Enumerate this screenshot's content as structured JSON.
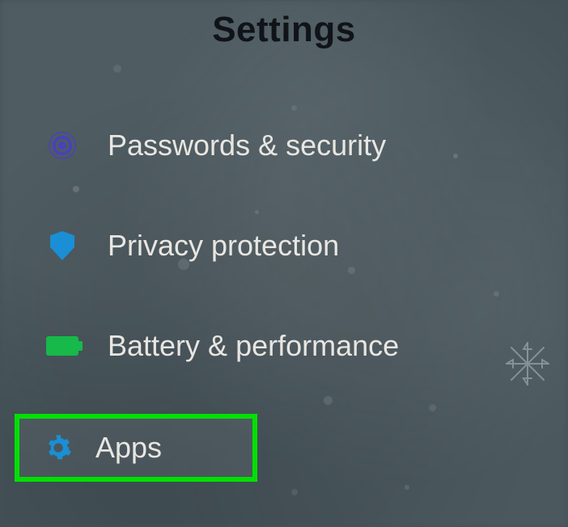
{
  "title": "Settings",
  "items": [
    {
      "label": "Passwords & security",
      "icon": "target-icon"
    },
    {
      "label": "Privacy protection",
      "icon": "shield-icon"
    },
    {
      "label": "Battery & performance",
      "icon": "battery-icon"
    },
    {
      "label": "Apps",
      "icon": "gear-icon",
      "highlighted": true
    }
  ],
  "highlight_color": "#00e000"
}
